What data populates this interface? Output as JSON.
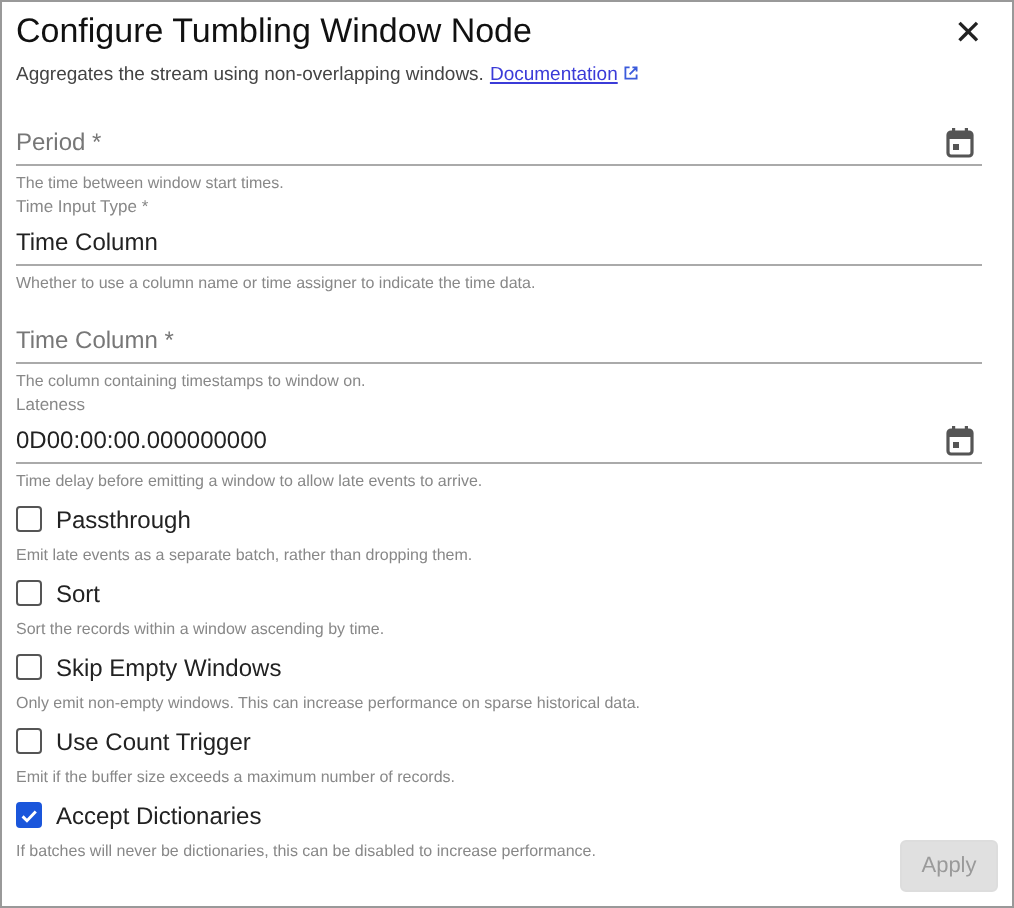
{
  "dialog": {
    "title": "Configure Tumbling Window Node",
    "close": "✕",
    "description": "Aggregates the stream using non-overlapping windows.",
    "link": "Documentation"
  },
  "fields": [
    {
      "kind": "duration",
      "placeholder": "Period *",
      "hint": "The time between window start times."
    },
    {
      "kind": "select",
      "label": "Time Input Type *",
      "value": "Time Column",
      "hint": "Whether to use a column name or time assigner to indicate the time data."
    },
    {
      "kind": "text",
      "placeholder": "Time Column *",
      "hint": "The column containing timestamps to window on."
    },
    {
      "kind": "duration",
      "label": "Lateness",
      "value": "0D00:00:00.000000000",
      "hint": "Time delay before emitting a window to allow late events to arrive."
    }
  ],
  "options": [
    {
      "label": "Passthrough",
      "checked": false,
      "hint": "Emit late events as a separate batch, rather than dropping them."
    },
    {
      "label": "Sort",
      "checked": false,
      "hint": "Sort the records within a window ascending by time."
    },
    {
      "label": "Skip Empty Windows",
      "checked": false,
      "hint": "Only emit non-empty windows. This can increase performance on sparse historical data."
    },
    {
      "label": "Use Count Trigger",
      "checked": false,
      "hint": "Emit if the buffer size exceeds a maximum number of records."
    },
    {
      "label": "Accept Dictionaries",
      "checked": true,
      "hint": "If batches will never be dictionaries, this can be disabled to increase performance."
    }
  ],
  "apply": {
    "label": "Apply",
    "disabled": true
  }
}
